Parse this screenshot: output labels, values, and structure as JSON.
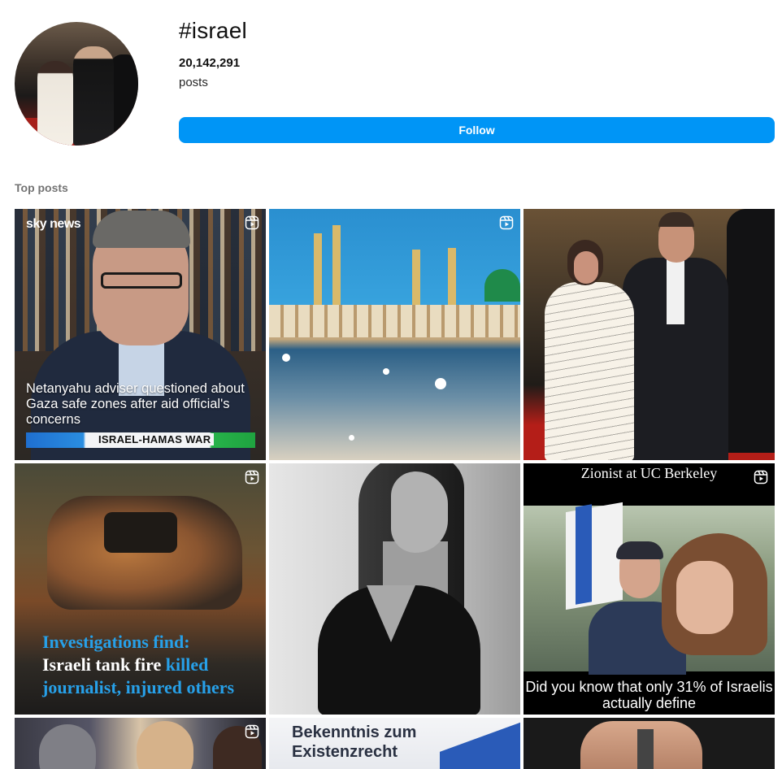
{
  "header": {
    "hashtag": "#israel",
    "post_count": "20,142,291",
    "post_count_label": "posts",
    "follow_label": "Follow",
    "accent_color": "#0095f6"
  },
  "top_posts": {
    "section_title": "Top posts",
    "tiles": [
      {
        "type": "reel",
        "source_logo": "sky news",
        "caption": "Netanyahu adviser questioned about Gaza safe zones after aid official's concerns",
        "banner": "ISRAEL-HAMAS WAR",
        "icon": "reels-icon"
      },
      {
        "type": "reel",
        "icon": "reels-icon"
      },
      {
        "type": "photo"
      },
      {
        "type": "reel",
        "caption_line1": "Investigations find:",
        "caption_line2_white": "Israeli tank fire ",
        "caption_line2_blue": "killed",
        "caption_line3": "journalist, injured others",
        "icon": "reels-icon"
      },
      {
        "type": "photo"
      },
      {
        "type": "reel",
        "top_text": "Zionist at UC Berkeley",
        "bottom_text": "Did you know that only 31% of Israelis actually define",
        "icon": "reels-icon"
      },
      {
        "type": "reel",
        "icon": "reels-icon"
      },
      {
        "type": "photo",
        "caption": "Bekenntnis zum Existenzrecht"
      },
      {
        "type": "photo"
      }
    ]
  }
}
